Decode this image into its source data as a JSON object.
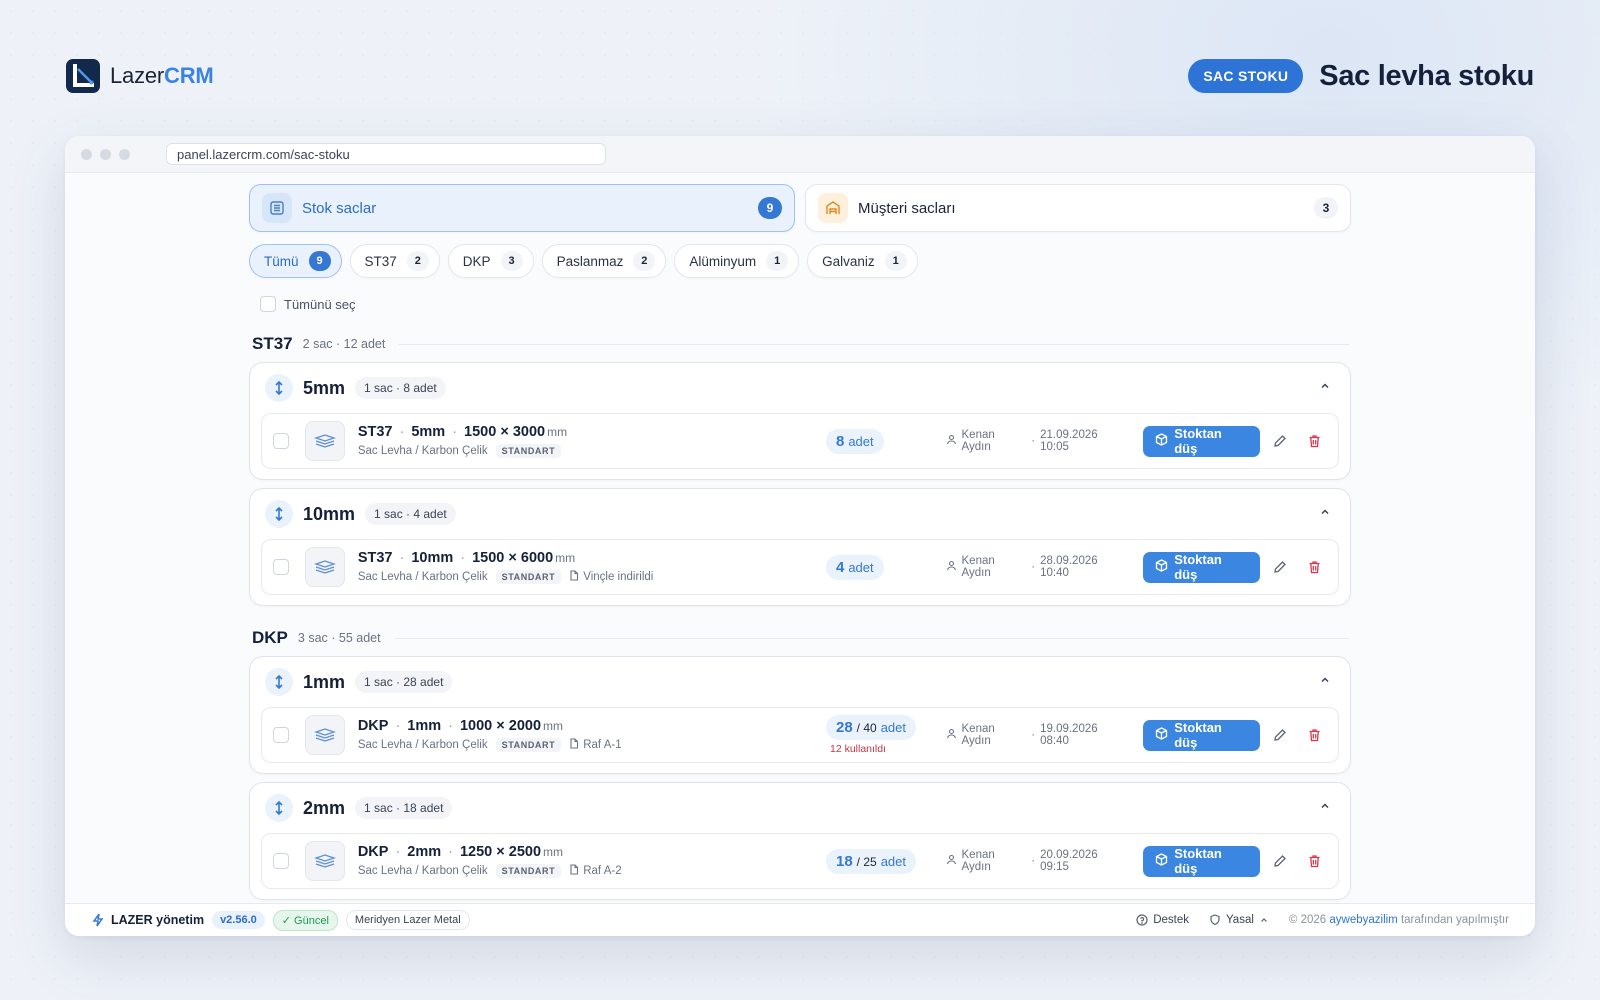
{
  "brand": {
    "name_a": "Lazer",
    "name_b": "CRM"
  },
  "header": {
    "tag": "SAC STOKU",
    "title": "Sac levha stoku"
  },
  "browser": {
    "url": "panel.lazercrm.com/sac-stoku"
  },
  "tabs": [
    {
      "label": "Stok saclar",
      "count": "9",
      "active": true,
      "icon": "building-icon"
    },
    {
      "label": "Müşteri sacları",
      "count": "3",
      "active": false,
      "icon": "warehouse-icon"
    }
  ],
  "filters": [
    {
      "label": "Tümü",
      "count": "9",
      "active": true
    },
    {
      "label": "ST37",
      "count": "2"
    },
    {
      "label": "DKP",
      "count": "3"
    },
    {
      "label": "Paslanmaz",
      "count": "2"
    },
    {
      "label": "Alüminyum",
      "count": "1"
    },
    {
      "label": "Galvaniz",
      "count": "1"
    }
  ],
  "select_all": "Tümünü seç",
  "groups": [
    {
      "name": "ST37",
      "summary": "2 sac · 12 adet",
      "subs": [
        {
          "thickness": "5mm",
          "count": "1 sac · 8 adet",
          "item": {
            "mat": "ST37",
            "thick": "5mm",
            "size": "1500 × 3000",
            "unit": "mm",
            "desc": "Sac Levha / Karbon Çelik",
            "type": "STANDART",
            "note": "",
            "qty": "8",
            "qty_total": "",
            "qty_unit": "adet",
            "used": "",
            "user": "Kenan Aydın",
            "date": "21.09.2026 10:05"
          }
        },
        {
          "thickness": "10mm",
          "count": "1 sac · 4 adet",
          "item": {
            "mat": "ST37",
            "thick": "10mm",
            "size": "1500 × 6000",
            "unit": "mm",
            "desc": "Sac Levha / Karbon Çelik",
            "type": "STANDART",
            "note": "Vinçle indirildi",
            "qty": "4",
            "qty_total": "",
            "qty_unit": "adet",
            "used": "",
            "user": "Kenan Aydın",
            "date": "28.09.2026 10:40"
          }
        }
      ]
    },
    {
      "name": "DKP",
      "summary": "3 sac · 55 adet",
      "subs": [
        {
          "thickness": "1mm",
          "count": "1 sac · 28 adet",
          "item": {
            "mat": "DKP",
            "thick": "1mm",
            "size": "1000 × 2000",
            "unit": "mm",
            "desc": "Sac Levha / Karbon Çelik",
            "type": "STANDART",
            "note": "Raf A-1",
            "qty": "28",
            "qty_total": "/ 40",
            "qty_unit": "adet",
            "used": "12 kullanıldı",
            "user": "Kenan Aydın",
            "date": "19.09.2026 08:40"
          }
        },
        {
          "thickness": "2mm",
          "count": "1 sac · 18 adet",
          "item": {
            "mat": "DKP",
            "thick": "2mm",
            "size": "1250 × 2500",
            "unit": "mm",
            "desc": "Sac Levha / Karbon Çelik",
            "type": "STANDART",
            "note": "Raf A-2",
            "qty": "18",
            "qty_total": "/ 25",
            "qty_unit": "adet",
            "used": "",
            "user": "Kenan Aydın",
            "date": "20.09.2026 09:15"
          }
        }
      ]
    }
  ],
  "actions": {
    "out": "Stoktan düş"
  },
  "footer": {
    "brand": "LAZER yönetim",
    "version": "v2.56.0",
    "status": "Güncel",
    "company": "Meridyen Lazer Metal",
    "support": "Destek",
    "legal": "Yasal",
    "copy_a": "© 2026",
    "copy_link": "aywebyazilim",
    "copy_b": "tarafından yapılmıştır"
  },
  "colors": {
    "accent": "#3a86e0",
    "brand_dark": "#13294b",
    "danger": "#d9364a",
    "success": "#1e9a4f"
  }
}
